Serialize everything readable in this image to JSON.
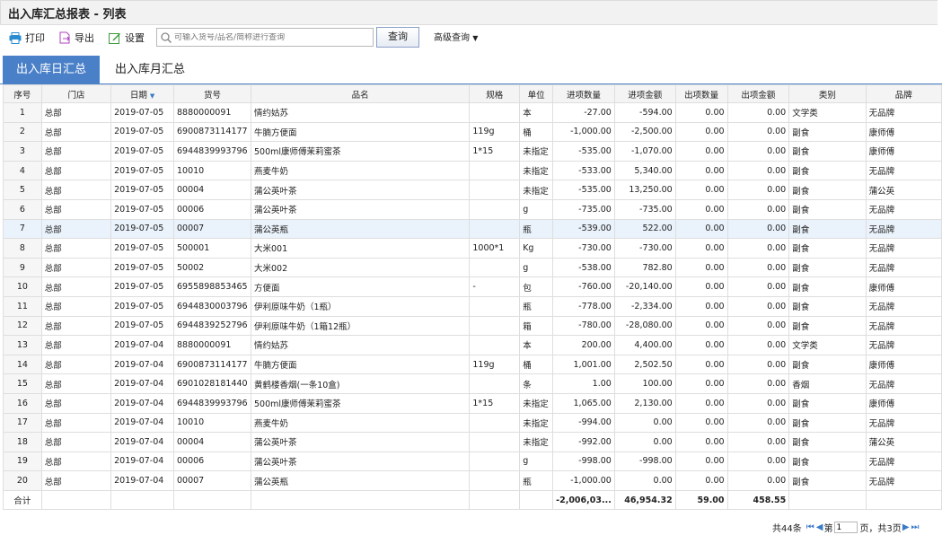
{
  "window": {
    "title": "出入库汇总报表 - 列表"
  },
  "toolbar": {
    "print": "打印",
    "export": "导出",
    "settings": "设置",
    "search_placeholder": "可输入货号/品名/简称进行查询",
    "query": "查询",
    "advanced": "高级查询"
  },
  "tabs": [
    "出入库日汇总",
    "出入库月汇总"
  ],
  "table": {
    "headers": [
      "序号",
      "门店",
      "日期",
      "货号",
      "品名",
      "规格",
      "单位",
      "进项数量",
      "进项金额",
      "出项数量",
      "出项金额",
      "类别",
      "品牌"
    ],
    "rows": [
      [
        "1",
        "总部",
        "2019-07-05",
        "8880000091",
        "情约姑苏",
        "",
        "本",
        "-27.00",
        "-594.00",
        "0.00",
        "0.00",
        "文学类",
        "无品牌"
      ],
      [
        "2",
        "总部",
        "2019-07-05",
        "6900873114177",
        "牛腩方便面",
        "119g",
        "桶",
        "-1,000.00",
        "-2,500.00",
        "0.00",
        "0.00",
        "副食",
        "康师傅"
      ],
      [
        "3",
        "总部",
        "2019-07-05",
        "6944839993796",
        "500ml康师傅茉莉蜜茶",
        "1*15",
        "未指定",
        "-535.00",
        "-1,070.00",
        "0.00",
        "0.00",
        "副食",
        "康师傅"
      ],
      [
        "4",
        "总部",
        "2019-07-05",
        "10010",
        "燕麦牛奶",
        "",
        "未指定",
        "-533.00",
        "5,340.00",
        "0.00",
        "0.00",
        "副食",
        "无品牌"
      ],
      [
        "5",
        "总部",
        "2019-07-05",
        "00004",
        "蒲公英叶茶",
        "",
        "未指定",
        "-535.00",
        "13,250.00",
        "0.00",
        "0.00",
        "副食",
        "蒲公英"
      ],
      [
        "6",
        "总部",
        "2019-07-05",
        "00006",
        "蒲公英叶茶",
        "",
        "g",
        "-735.00",
        "-735.00",
        "0.00",
        "0.00",
        "副食",
        "无品牌"
      ],
      [
        "7",
        "总部",
        "2019-07-05",
        "00007",
        "蒲公英瓶",
        "",
        "瓶",
        "-539.00",
        "522.00",
        "0.00",
        "0.00",
        "副食",
        "无品牌"
      ],
      [
        "8",
        "总部",
        "2019-07-05",
        "500001",
        "大米001",
        "1000*1",
        "Kg",
        "-730.00",
        "-730.00",
        "0.00",
        "0.00",
        "副食",
        "无品牌"
      ],
      [
        "9",
        "总部",
        "2019-07-05",
        "50002",
        "大米002",
        "",
        "g",
        "-538.00",
        "782.80",
        "0.00",
        "0.00",
        "副食",
        "无品牌"
      ],
      [
        "10",
        "总部",
        "2019-07-05",
        "6955898853465",
        "方便面",
        "-",
        "包",
        "-760.00",
        "-20,140.00",
        "0.00",
        "0.00",
        "副食",
        "康师傅"
      ],
      [
        "11",
        "总部",
        "2019-07-05",
        "6944830003796",
        "伊利原味牛奶（1瓶）",
        "",
        "瓶",
        "-778.00",
        "-2,334.00",
        "0.00",
        "0.00",
        "副食",
        "无品牌"
      ],
      [
        "12",
        "总部",
        "2019-07-05",
        "6944839252796",
        "伊利原味牛奶（1箱12瓶）",
        "",
        "箱",
        "-780.00",
        "-28,080.00",
        "0.00",
        "0.00",
        "副食",
        "无品牌"
      ],
      [
        "13",
        "总部",
        "2019-07-04",
        "8880000091",
        "情约姑苏",
        "",
        "本",
        "200.00",
        "4,400.00",
        "0.00",
        "0.00",
        "文学类",
        "无品牌"
      ],
      [
        "14",
        "总部",
        "2019-07-04",
        "6900873114177",
        "牛腩方便面",
        "119g",
        "桶",
        "1,001.00",
        "2,502.50",
        "0.00",
        "0.00",
        "副食",
        "康师傅"
      ],
      [
        "15",
        "总部",
        "2019-07-04",
        "6901028181440",
        "黄鹤楼香烟(一条10盒)",
        "",
        "条",
        "1.00",
        "100.00",
        "0.00",
        "0.00",
        "香烟",
        "无品牌"
      ],
      [
        "16",
        "总部",
        "2019-07-04",
        "6944839993796",
        "500ml康师傅茉莉蜜茶",
        "1*15",
        "未指定",
        "1,065.00",
        "2,130.00",
        "0.00",
        "0.00",
        "副食",
        "康师傅"
      ],
      [
        "17",
        "总部",
        "2019-07-04",
        "10010",
        "燕麦牛奶",
        "",
        "未指定",
        "-994.00",
        "0.00",
        "0.00",
        "0.00",
        "副食",
        "无品牌"
      ],
      [
        "18",
        "总部",
        "2019-07-04",
        "00004",
        "蒲公英叶茶",
        "",
        "未指定",
        "-992.00",
        "0.00",
        "0.00",
        "0.00",
        "副食",
        "蒲公英"
      ],
      [
        "19",
        "总部",
        "2019-07-04",
        "00006",
        "蒲公英叶茶",
        "",
        "g",
        "-998.00",
        "-998.00",
        "0.00",
        "0.00",
        "副食",
        "无品牌"
      ],
      [
        "20",
        "总部",
        "2019-07-04",
        "00007",
        "蒲公英瓶",
        "",
        "瓶",
        "-1,000.00",
        "0.00",
        "0.00",
        "0.00",
        "副食",
        "无品牌"
      ]
    ],
    "highlighted_row": "7",
    "total": {
      "label": "合计",
      "in_qty": "-2,006,03...",
      "in_amt": "46,954.32",
      "out_qty": "59.00",
      "out_amt": "458.55"
    }
  },
  "pager": {
    "total_prefix": "共44条",
    "page_prefix": "第",
    "current": "1",
    "page_suffix": "页，共3页"
  },
  "colors": {
    "accent": "#4a80c8",
    "highlight_row": "#eaf2fb"
  }
}
